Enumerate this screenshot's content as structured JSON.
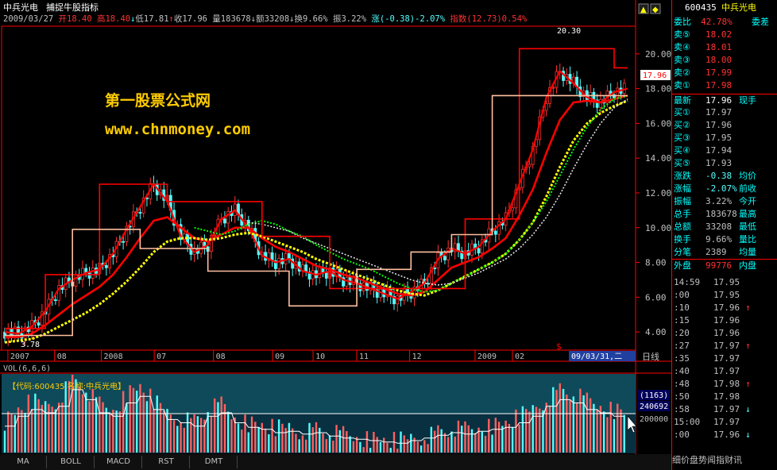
{
  "title": {
    "stock_name": "中兵光电",
    "indicator_name": "捕捉牛股指标"
  },
  "info_line": {
    "date": "2009/03/27",
    "open_label": "开",
    "open": "18.40",
    "high_label": "高",
    "high": "18.40",
    "low_label": "低",
    "low": "17.81",
    "close_label": "收",
    "close": "17.96",
    "volume_label": "量",
    "volume": "183678",
    "amount_label": "额",
    "amount": "33208",
    "turnover_label": "换",
    "turnover": "9.66%",
    "amplitude_label": "振",
    "amplitude": "3.22%",
    "change_label": "涨",
    "change": "(-0.38)-2.07%",
    "index_label": "指数",
    "index": "(12.73)0.54%"
  },
  "watermark": {
    "line1": "第一股票公式网",
    "line2": "www.chnmoney.com"
  },
  "chart_annotations": {
    "peak_label": "20.30",
    "trough_label": "3.78",
    "current_price_tag": "17.96"
  },
  "chart_data": {
    "type": "line",
    "price_axis_ticks": [
      "20.00",
      "18.00",
      "16.00",
      "14.00",
      "12.00",
      "10.00",
      "8.00",
      "6.00",
      "4.00"
    ],
    "ylim": [
      3,
      21.5
    ],
    "x_tick_labels": [
      "2007",
      "08",
      "2008",
      "07",
      "08",
      "09",
      "10",
      "11",
      "12",
      "2009",
      "02"
    ],
    "date_badge": "09/03/31,二",
    "period_label": "日线",
    "volume_panel": {
      "label": "VOL(6,6,6)",
      "info_text": "【代码:600435 名称:中兵光电】",
      "tick_labels": [
        "(1163)",
        "240692",
        "200000"
      ]
    },
    "series": [
      {
        "values": [
          4.0,
          3.9,
          4.3,
          5.2,
          6.5,
          7.0,
          7.4,
          7.6,
          8.5,
          9.9,
          11.2,
          12.5,
          11.5,
          9.5,
          8.6,
          9.0,
          10.5,
          11.0,
          10.0,
          8.4,
          8.0,
          8.2,
          7.5,
          7.3,
          7.5,
          7.0,
          6.8,
          6.5,
          6.2,
          5.9,
          6.3,
          6.8,
          8.2,
          8.8,
          8.5,
          8.9,
          9.8,
          10.5,
          12.5,
          14.5,
          17.5,
          19.0,
          18.3,
          17.5,
          17.2,
          17.8,
          18.0
        ]
      },
      {
        "values": [
          3.7,
          3.7,
          3.9,
          4.4,
          5.0,
          5.6,
          6.1,
          6.6,
          7.3,
          8.3,
          9.4,
          10.4,
          10.6,
          10.0,
          9.4,
          9.2,
          9.6,
          10.0,
          10.0,
          9.4,
          8.9,
          8.6,
          8.2,
          7.8,
          7.6,
          7.3,
          7.1,
          6.8,
          6.5,
          6.2,
          6.1,
          6.3,
          7.0,
          7.7,
          8.0,
          8.3,
          8.8,
          9.4,
          10.7,
          12.2,
          14.3,
          16.2,
          17.2,
          17.3,
          17.2,
          17.4,
          17.6
        ]
      },
      {
        "values": [
          3.4,
          3.5,
          3.6,
          3.9,
          4.3,
          4.7,
          5.1,
          5.6,
          6.2,
          6.9,
          7.7,
          8.6,
          9.2,
          9.4,
          9.4,
          9.3,
          9.4,
          9.6,
          9.7,
          9.5,
          9.2,
          8.9,
          8.6,
          8.2,
          7.9,
          7.6,
          7.3,
          7.0,
          6.7,
          6.4,
          6.2,
          6.1,
          6.4,
          6.8,
          7.2,
          7.6,
          8.0,
          8.5,
          9.3,
          10.3,
          11.8,
          13.5,
          15.0,
          16.0,
          16.6,
          17.0,
          17.3
        ]
      },
      {
        "values": [
          null,
          null,
          null,
          null,
          null,
          null,
          null,
          null,
          null,
          null,
          null,
          null,
          null,
          null,
          10.0,
          9.8,
          9.6,
          9.8,
          10.2,
          10.4,
          10.2,
          9.8,
          9.5,
          9.0,
          8.6,
          8.2,
          7.9,
          7.6,
          7.2,
          6.8,
          6.5,
          6.3,
          6.4,
          6.8,
          7.2,
          7.6,
          8.0,
          8.5,
          9.3,
          10.3,
          11.5,
          13.0,
          14.5,
          15.8,
          16.8,
          17.4,
          17.6
        ]
      },
      {
        "values": [
          null,
          null,
          null,
          null,
          null,
          null,
          null,
          null,
          null,
          null,
          null,
          null,
          null,
          null,
          null,
          null,
          null,
          null,
          10.3,
          10.2,
          10.0,
          9.8,
          9.4,
          9.1,
          8.8,
          8.5,
          8.2,
          7.9,
          7.6,
          7.3,
          7.0,
          6.8,
          6.7,
          6.8,
          7.1,
          7.4,
          7.8,
          8.2,
          8.8,
          9.6,
          10.6,
          11.9,
          13.4,
          14.8,
          16.0,
          16.9,
          17.4
        ]
      },
      {
        "values": [
          4.2,
          4.2,
          4.2,
          7.3,
          7.3,
          7.3,
          7.3,
          12.5,
          12.5,
          12.5,
          12.5,
          12.5,
          11.5,
          11.5,
          11.5,
          11.5,
          11.5,
          11.5,
          11.5,
          9.5,
          9.5,
          9.5,
          9.5,
          9.5,
          6.5,
          6.5,
          6.5,
          6.5,
          6.5,
          6.5,
          6.5,
          6.5,
          6.5,
          6.5,
          10.5,
          10.5,
          10.5,
          10.5,
          20.3,
          20.3,
          20.3,
          20.3,
          20.3,
          20.3,
          20.3,
          19.2,
          19.2
        ]
      },
      {
        "values": [
          3.8,
          3.8,
          3.8,
          3.8,
          3.8,
          9.9,
          9.9,
          9.9,
          9.9,
          9.9,
          8.8,
          8.8,
          8.8,
          8.8,
          8.8,
          7.5,
          7.5,
          7.5,
          7.5,
          7.5,
          7.5,
          5.5,
          5.5,
          5.5,
          5.5,
          5.5,
          7.6,
          7.6,
          7.6,
          7.6,
          8.6,
          8.6,
          8.6,
          9.6,
          9.6,
          9.6,
          17.6,
          17.6,
          17.6,
          17.6,
          17.6,
          17.6,
          17.6,
          17.6,
          17.6,
          17.6,
          17.6
        ]
      }
    ],
    "volume": [
      40,
      55,
      65,
      60,
      70,
      95,
      80,
      60,
      55,
      75,
      85,
      65,
      50,
      45,
      40,
      55,
      60,
      45,
      38,
      35,
      30,
      32,
      28,
      30,
      25,
      22,
      20,
      18,
      16,
      14,
      18,
      22,
      26,
      30,
      28,
      32,
      35,
      38,
      45,
      55,
      70,
      80,
      75,
      65,
      60,
      55,
      50
    ]
  },
  "side_panel": {
    "header": {
      "code": "600435",
      "name": "中兵光电"
    },
    "ratio_row": {
      "label": "委比",
      "value": "42.78%",
      "label2": "委差"
    },
    "asks": [
      {
        "label": "卖⑤",
        "price": "18.02"
      },
      {
        "label": "卖④",
        "price": "18.01"
      },
      {
        "label": "卖③",
        "price": "18.00"
      },
      {
        "label": "卖②",
        "price": "17.99"
      },
      {
        "label": "卖①",
        "price": "17.98"
      }
    ],
    "latest": {
      "label": "最新",
      "price": "17.96",
      "label2": "现手"
    },
    "bids": [
      {
        "label": "买①",
        "price": "17.97"
      },
      {
        "label": "买②",
        "price": "17.96"
      },
      {
        "label": "买③",
        "price": "17.95"
      },
      {
        "label": "买④",
        "price": "17.94"
      },
      {
        "label": "买⑤",
        "price": "17.93"
      }
    ],
    "stats": [
      {
        "label": "涨跌",
        "value": "-0.38",
        "label2": "均价"
      },
      {
        "label": "涨幅",
        "value": "-2.07%",
        "label2": "前收"
      },
      {
        "label": "振幅",
        "value": "3.22%",
        "label2": "今开"
      },
      {
        "label": "总手",
        "value": "183678",
        "label2": "最高"
      },
      {
        "label": "总额",
        "value": "33208",
        "label2": "最低"
      },
      {
        "label": "换手",
        "value": "9.66%",
        "label2": "量比"
      },
      {
        "label": "分笔",
        "value": "2389",
        "label2": "均量"
      },
      {
        "label": "外盘",
        "value": "99776",
        "label2": "内盘"
      }
    ],
    "ticks": [
      {
        "time": "14:59",
        "price": "17.95",
        "arrow": ""
      },
      {
        "time": ":00",
        "price": "17.95",
        "arrow": ""
      },
      {
        "time": ":10",
        "price": "17.96",
        "arrow": "↑"
      },
      {
        "time": ":15",
        "price": "17.96",
        "arrow": ""
      },
      {
        "time": ":20",
        "price": "17.96",
        "arrow": ""
      },
      {
        "time": ":27",
        "price": "17.97",
        "arrow": "↑"
      },
      {
        "time": ":35",
        "price": "17.97",
        "arrow": ""
      },
      {
        "time": ":40",
        "price": "17.97",
        "arrow": ""
      },
      {
        "time": ":48",
        "price": "17.98",
        "arrow": "↑"
      },
      {
        "time": ":50",
        "price": "17.98",
        "arrow": ""
      },
      {
        "time": ":58",
        "price": "17.97",
        "arrow": "↓"
      },
      {
        "time": "15:00",
        "price": "17.97",
        "arrow": ""
      },
      {
        "time": ":00",
        "price": "17.96",
        "arrow": "↓"
      }
    ],
    "footer_tabs": "细价盘势闻指财讯"
  },
  "bottom_tabs": [
    "MA",
    "BOLL",
    "MACD",
    "RST",
    "DMT"
  ],
  "colors": {
    "up": "#ff3232",
    "down": "#54ffff",
    "label_cyan": "#00ffff",
    "yellow": "#ffff00",
    "red_line": "#ff0000",
    "green_line": "#00ff00",
    "white_line": "#e0e0e0",
    "salmon_line": "#ffc0a0",
    "grid": "#ff0000",
    "watermark": "#ffcc00"
  }
}
